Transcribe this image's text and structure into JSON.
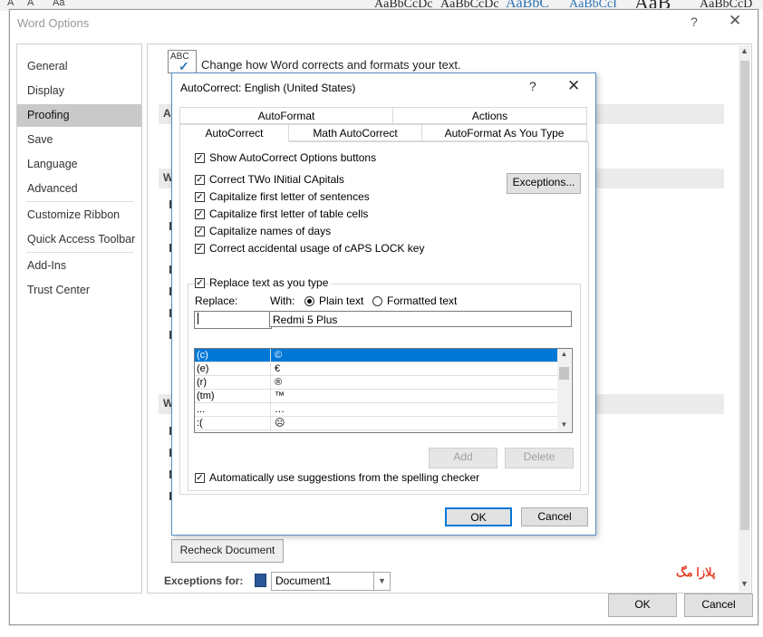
{
  "ribbon": {
    "glyphs": [
      "A",
      "A",
      "Aa"
    ],
    "styles": [
      "AaBbCcDc",
      "AaBbCcDc",
      "AaBbC",
      "AaBbCcI",
      "AaB",
      "AaBbCcD"
    ]
  },
  "word_options": {
    "title": "Word Options",
    "help": "?",
    "close": "✕",
    "nav": {
      "items": [
        "General",
        "Display",
        "Proofing",
        "Save",
        "Language",
        "Advanced",
        "Customize Ribbon",
        "Quick Access Toolbar",
        "Add-Ins",
        "Trust Center"
      ],
      "selected": "Proofing"
    },
    "heading": "Change how Word corrects and formats your text.",
    "abc_icon_text": "ABC",
    "section_letters": [
      "A",
      "W",
      "W"
    ],
    "recheck_button": "Recheck Document",
    "exceptions_for_label": "Exceptions for:",
    "exceptions_for_value": "Document1",
    "ok": "OK",
    "cancel": "Cancel"
  },
  "watermark": "پلازا مگ",
  "autocorrect": {
    "title": "AutoCorrect: English (United States)",
    "help": "?",
    "close": "✕",
    "tabs_top": [
      "AutoFormat",
      "Actions"
    ],
    "tabs_bottom": [
      "AutoCorrect",
      "Math AutoCorrect",
      "AutoFormat As You Type"
    ],
    "active_tab": "AutoCorrect",
    "options": {
      "show_buttons": {
        "label": "Show AutoCorrect Options buttons",
        "checked": true
      },
      "two_initial": {
        "label": "Correct TWo INitial CApitals",
        "checked": true
      },
      "cap_sentence": {
        "label": "Capitalize first letter of sentences",
        "checked": true
      },
      "cap_table": {
        "label": "Capitalize first letter of table cells",
        "checked": true
      },
      "cap_days": {
        "label": "Capitalize names of days",
        "checked": true
      },
      "caps_lock": {
        "label": "Correct accidental usage of cAPS LOCK key",
        "checked": true
      },
      "replace_as_type": {
        "label": "Replace text as you type",
        "checked": true
      },
      "auto_suggest": {
        "label": "Automatically use suggestions from the spelling checker",
        "checked": true
      }
    },
    "exceptions_button": "Exceptions...",
    "replace_label": "Replace:",
    "with_label": "With:",
    "plain_text": {
      "label": "Plain text",
      "selected": true
    },
    "formatted_text": {
      "label": "Formatted text",
      "selected": false
    },
    "replace_value": "",
    "with_value": "Redmi 5 Plus",
    "entries": [
      {
        "replace": "(c)",
        "with": "©",
        "selected": true
      },
      {
        "replace": "(e)",
        "with": "€",
        "selected": false
      },
      {
        "replace": "(r)",
        "with": "®",
        "selected": false
      },
      {
        "replace": "(tm)",
        "with": "™",
        "selected": false
      },
      {
        "replace": "...",
        "with": "…",
        "selected": false
      },
      {
        "replace": ":(",
        "with": "☹",
        "selected": false
      }
    ],
    "add_button": "Add",
    "delete_button": "Delete",
    "ok": "OK",
    "cancel": "Cancel"
  }
}
